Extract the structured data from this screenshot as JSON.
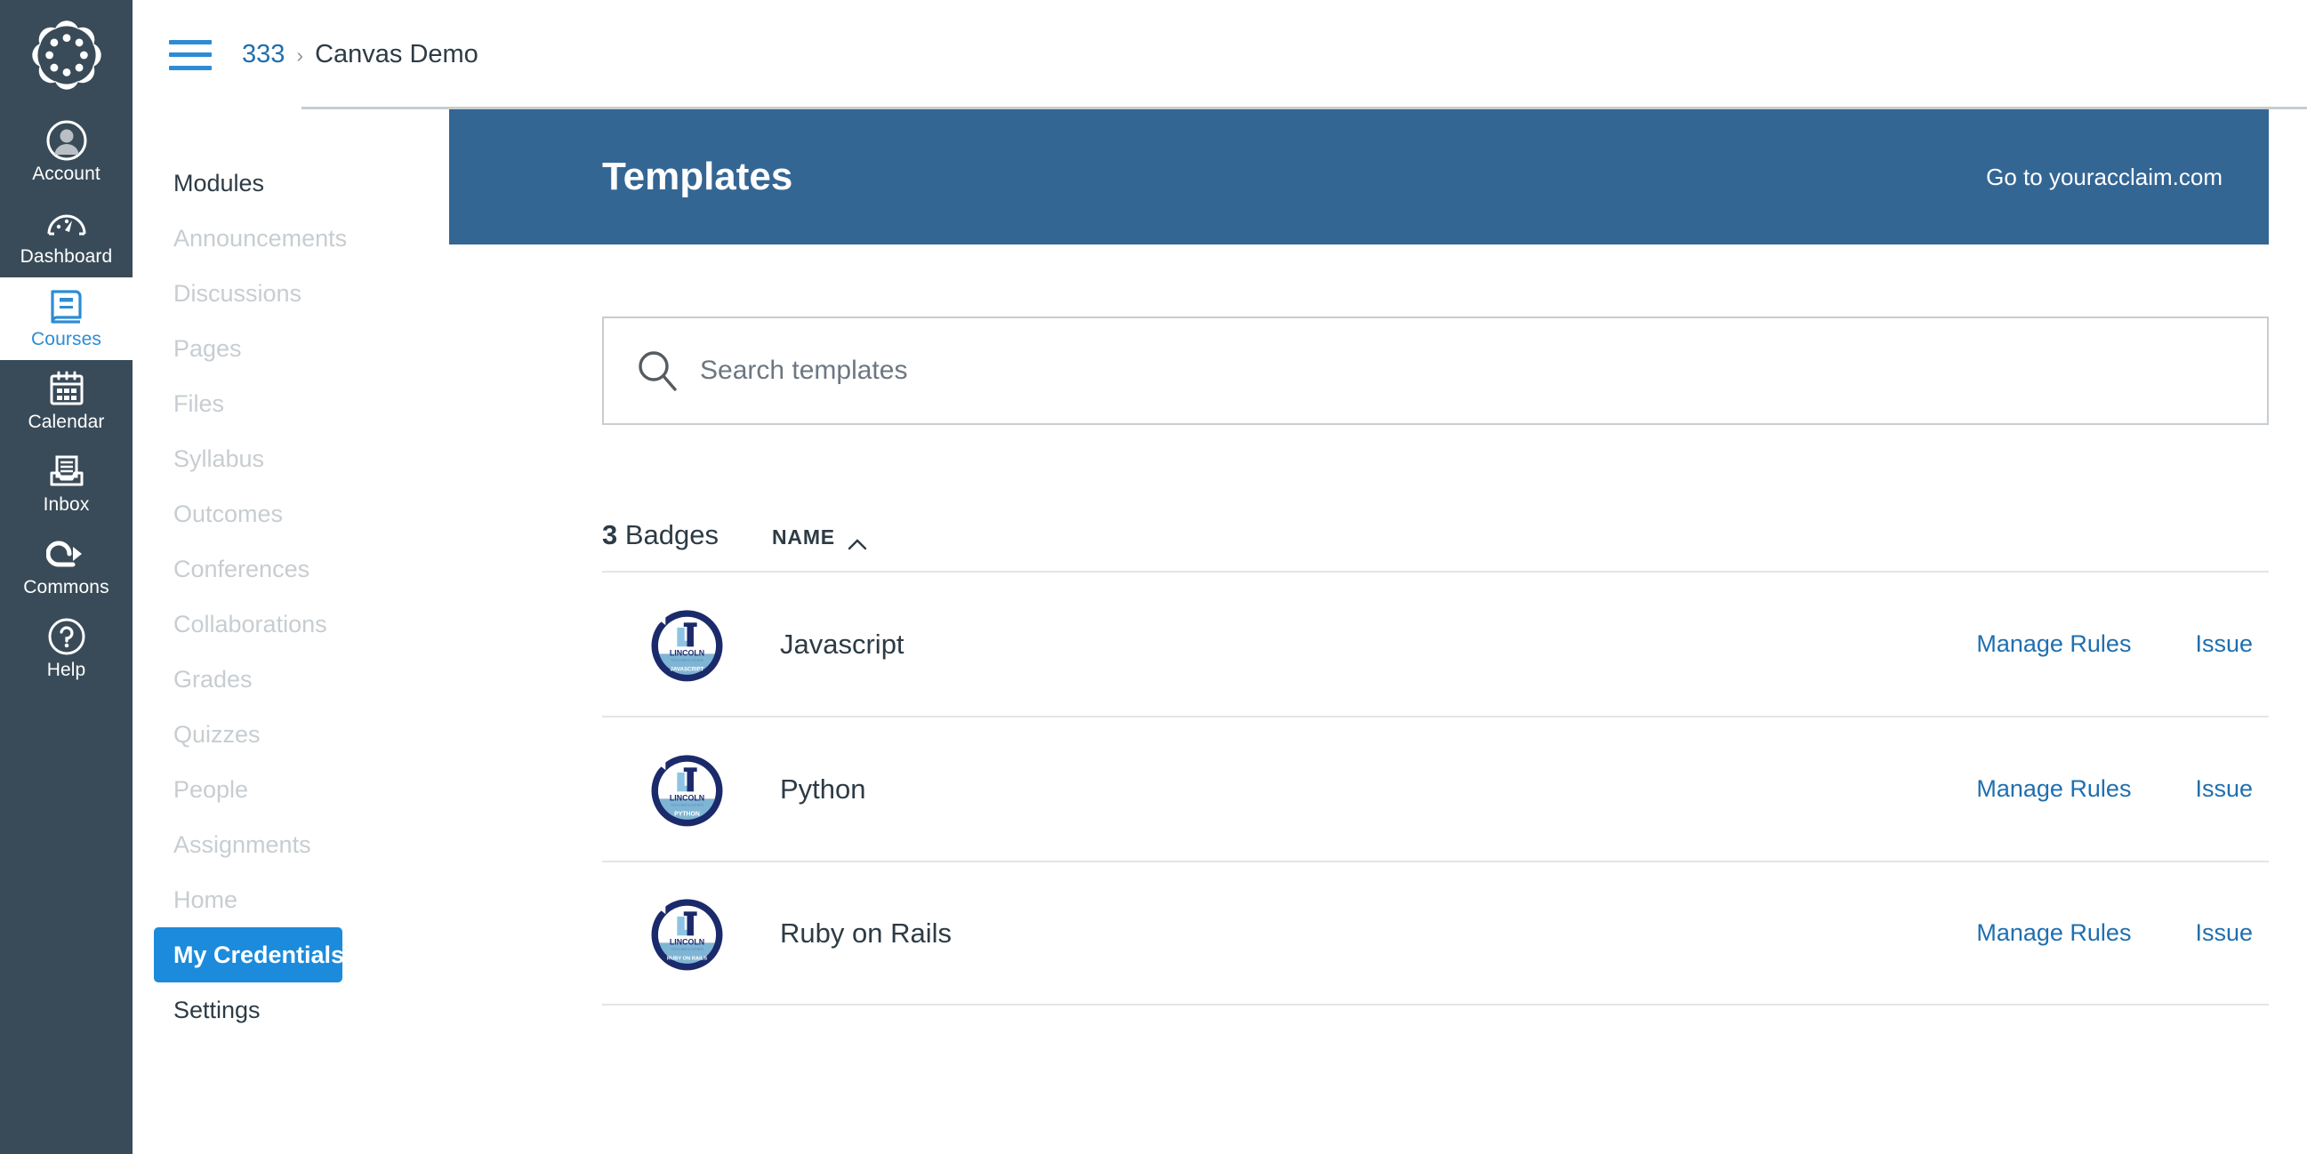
{
  "global_nav": {
    "logo_icon": "canvas-logo-icon",
    "items": [
      {
        "label": "Account",
        "icon": "user-avatar-icon",
        "active": false
      },
      {
        "label": "Dashboard",
        "icon": "gauge-icon",
        "active": false
      },
      {
        "label": "Courses",
        "icon": "book-icon",
        "active": true
      },
      {
        "label": "Calendar",
        "icon": "calendar-icon",
        "active": false
      },
      {
        "label": "Inbox",
        "icon": "inbox-tray-icon",
        "active": false
      },
      {
        "label": "Commons",
        "icon": "arrow-loop-icon",
        "active": false
      },
      {
        "label": "Help",
        "icon": "question-circle-icon",
        "active": false
      }
    ]
  },
  "breadcrumb": {
    "menu_icon": "hamburger-menu-icon",
    "course_code": "333",
    "separator": "›",
    "current": "Canvas Demo"
  },
  "course_nav": {
    "items": [
      {
        "label": "Modules",
        "state": "enabled"
      },
      {
        "label": "Announcements",
        "state": "disabled"
      },
      {
        "label": "Discussions",
        "state": "disabled"
      },
      {
        "label": "Pages",
        "state": "disabled"
      },
      {
        "label": "Files",
        "state": "disabled"
      },
      {
        "label": "Syllabus",
        "state": "disabled"
      },
      {
        "label": "Outcomes",
        "state": "disabled"
      },
      {
        "label": "Conferences",
        "state": "disabled"
      },
      {
        "label": "Collaborations",
        "state": "disabled"
      },
      {
        "label": "Grades",
        "state": "disabled"
      },
      {
        "label": "Quizzes",
        "state": "disabled"
      },
      {
        "label": "People",
        "state": "disabled"
      },
      {
        "label": "Assignments",
        "state": "disabled"
      },
      {
        "label": "Home",
        "state": "disabled"
      },
      {
        "label": "My Credentials",
        "state": "active"
      },
      {
        "label": "Settings",
        "state": "enabled"
      }
    ]
  },
  "banner": {
    "title": "Templates",
    "link_label": "Go to youracclaim.com",
    "background_color": "#346694"
  },
  "search": {
    "icon": "search-icon",
    "placeholder": "Search templates",
    "value": ""
  },
  "list": {
    "count": "3",
    "count_suffix": " Badges",
    "sort_label": "NAME",
    "sort_direction_icon": "caret-up-icon",
    "actions": {
      "manage": "Manage Rules",
      "issue": "Issue"
    },
    "rows": [
      {
        "name": "Javascript",
        "badge_caption": "JAVASCRIPT",
        "badge_org_line1": "LINCOLN",
        "badge_org_line2": "TECHNOLOGIES",
        "badge_monogram": "LT"
      },
      {
        "name": "Python",
        "badge_caption": "PYTHON",
        "badge_org_line1": "LINCOLN",
        "badge_org_line2": "TECHNOLOGIES",
        "badge_monogram": "LT"
      },
      {
        "name": "Ruby on Rails",
        "badge_caption": "RUBY ON RAILS",
        "badge_org_line1": "LINCOLN",
        "badge_org_line2": "TECHNOLOGIES",
        "badge_monogram": "LT"
      }
    ]
  },
  "colors": {
    "nav_background": "#394B58",
    "accent_blue": "#2D8CD4",
    "active_pill": "#1C8BDC",
    "link_blue": "#1F6FAF",
    "badge_navy": "#1B2A6B",
    "badge_lightblue": "#7FB5D4"
  }
}
